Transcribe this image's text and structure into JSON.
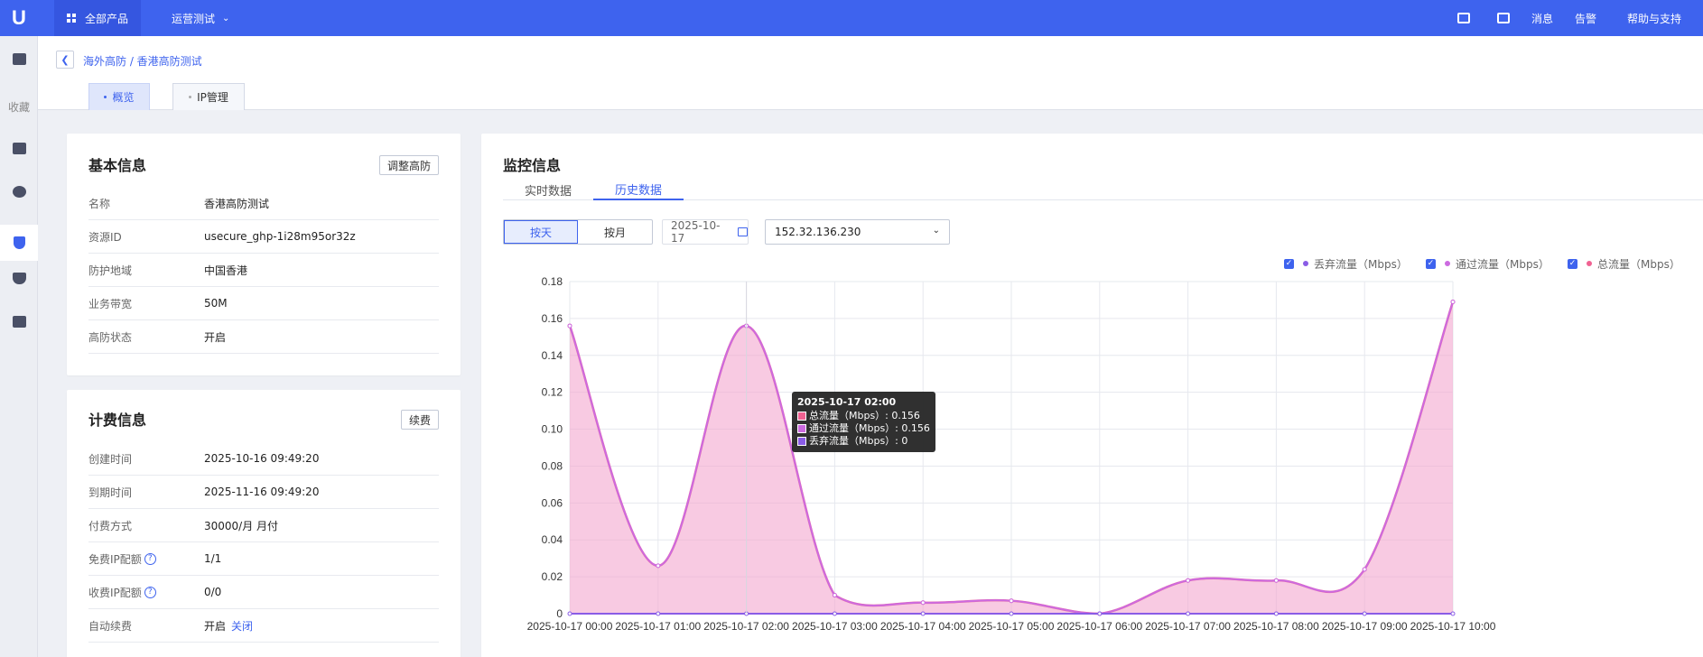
{
  "topbar": {
    "logo": "U",
    "all_products": "全部产品",
    "project": "运营测试",
    "messages": "消息",
    "alerts": "告警",
    "help": "帮助与支持"
  },
  "sidebar": {
    "collect_label": "收藏"
  },
  "header": {
    "breadcrumb": "海外高防 / 香港高防测试",
    "tabs": [
      {
        "label": "概览"
      },
      {
        "label": "IP管理"
      }
    ]
  },
  "basic_info": {
    "title": "基本信息",
    "adjust_button": "调整高防",
    "rows": [
      {
        "key": "名称",
        "value": "香港高防测试"
      },
      {
        "key": "资源ID",
        "value": "usecure_ghp-1i28m95or32z"
      },
      {
        "key": "防护地域",
        "value": "中国香港"
      },
      {
        "key": "业务带宽",
        "value": "50M"
      },
      {
        "key": "高防状态",
        "value": "开启"
      }
    ]
  },
  "billing_info": {
    "title": "计费信息",
    "renew_button": "续费",
    "rows": [
      {
        "key": "创建时间",
        "value": "2025-10-16 09:49:20"
      },
      {
        "key": "到期时间",
        "value": "2025-11-16 09:49:20"
      },
      {
        "key": "付费方式",
        "value": "30000/月 月付"
      },
      {
        "key": "免费IP配额",
        "value": "1/1"
      },
      {
        "key": "收费IP配额",
        "value": "0/0"
      },
      {
        "key": "自动续费",
        "value": "开启",
        "action": "关闭"
      }
    ]
  },
  "monitor": {
    "title": "监控信息",
    "tabs": [
      {
        "label": "实时数据"
      },
      {
        "label": "历史数据"
      }
    ],
    "by_day": "按天",
    "by_month": "按月",
    "date": "2025-10-17",
    "ip": "152.32.136.230"
  },
  "chart_data": {
    "type": "area",
    "x": [
      "2025-10-17 00:00",
      "2025-10-17 01:00",
      "2025-10-17 02:00",
      "2025-10-17 03:00",
      "2025-10-17 04:00",
      "2025-10-17 05:00",
      "2025-10-17 06:00",
      "2025-10-17 07:00",
      "2025-10-17 08:00",
      "2025-10-17 09:00",
      "2025-10-17 10:00"
    ],
    "ylim": [
      0,
      0.18
    ],
    "yticks": [
      "0",
      "0.02",
      "0.04",
      "0.06",
      "0.08",
      "0.10",
      "0.12",
      "0.14",
      "0.16",
      "0.18"
    ],
    "legend_position": "top-right",
    "grid": true,
    "series": [
      {
        "name": "丢弃流量（Mbps）",
        "color": "#8a5ce6",
        "values": [
          0,
          0,
          0,
          0,
          0,
          0,
          0,
          0,
          0,
          0,
          0
        ]
      },
      {
        "name": "通过流量（Mbps）",
        "color": "#cc6be0",
        "values": [
          0.156,
          0.026,
          0.156,
          0.01,
          0.006,
          0.007,
          0,
          0.018,
          0.018,
          0.024,
          0.169
        ]
      },
      {
        "name": "总流量（Mbps）",
        "color": "#f06292",
        "values": [
          0.156,
          0.026,
          0.156,
          0.01,
          0.006,
          0.007,
          0,
          0.018,
          0.018,
          0.024,
          0.169
        ]
      }
    ],
    "tooltip": {
      "title": "2025-10-17 02:00",
      "lines": [
        {
          "label": "总流量（Mbps）: 0.156",
          "color": "#f06292"
        },
        {
          "label": "通过流量（Mbps）: 0.156",
          "color": "#cc6be0"
        },
        {
          "label": "丢弃流量（Mbps）: 0",
          "color": "#8a5ce6"
        }
      ]
    }
  }
}
